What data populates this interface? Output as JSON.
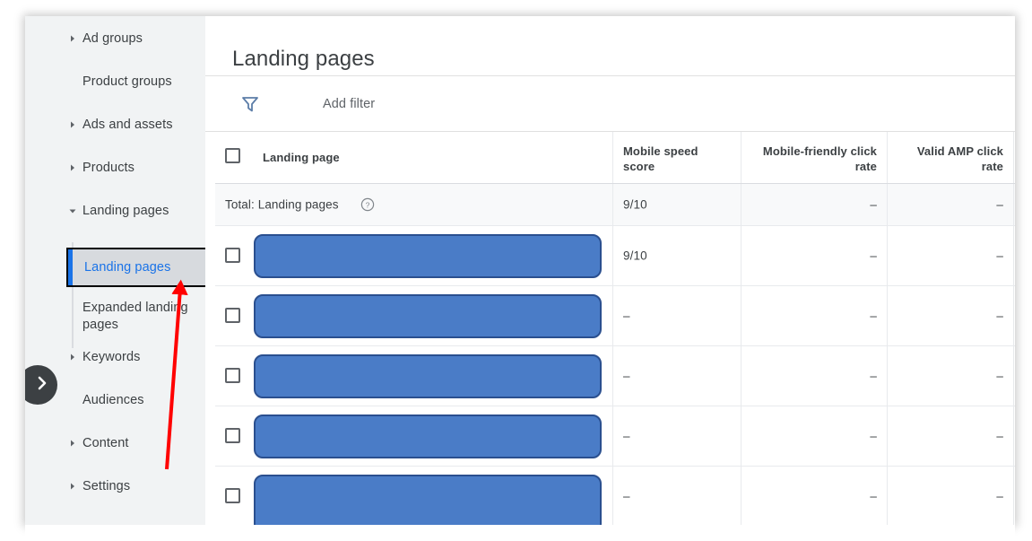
{
  "sidebar": {
    "items": [
      {
        "label": "Ad groups",
        "caret": "collapsed",
        "indent": "top"
      },
      {
        "label": "Product groups",
        "caret": "none",
        "indent": "top"
      },
      {
        "label": "Ads and assets",
        "caret": "collapsed",
        "indent": "top"
      },
      {
        "label": "Products",
        "caret": "collapsed",
        "indent": "top"
      },
      {
        "label": "Landing pages",
        "caret": "expanded",
        "indent": "top"
      },
      {
        "label": "Expanded landing pages",
        "caret": "none",
        "indent": "sub"
      },
      {
        "label": "Keywords",
        "caret": "collapsed",
        "indent": "top"
      },
      {
        "label": "Audiences",
        "caret": "none",
        "indent": "top"
      },
      {
        "label": "Content",
        "caret": "collapsed",
        "indent": "top"
      },
      {
        "label": "Settings",
        "caret": "collapsed",
        "indent": "top"
      }
    ],
    "selected_item": {
      "label": "Landing pages",
      "accent_color": "#1a73e8",
      "background_color": "#d7dade"
    },
    "collapse_button_icon": "chevron-right-icon"
  },
  "header": {
    "title": "Landing pages"
  },
  "filter_bar": {
    "icon": "filter-funnel-icon",
    "add_filter_label": "Add filter"
  },
  "table": {
    "columns": [
      {
        "key": "landing_page",
        "label": "Landing page",
        "align": "left"
      },
      {
        "key": "mobile_speed_score",
        "label": "Mobile speed score",
        "align": "left"
      },
      {
        "key": "mobile_friendly_click_rate",
        "label": "Mobile-friendly click rate",
        "align": "right"
      },
      {
        "key": "valid_amp_click_rate",
        "label": "Valid AMP click rate",
        "align": "right"
      }
    ],
    "total_row": {
      "label": "Total: Landing pages",
      "help_icon": "help-circle-icon",
      "mobile_speed_score": "9/10",
      "mobile_friendly_click_rate": "–",
      "valid_amp_click_rate": "–"
    },
    "rows": [
      {
        "landing_page": "",
        "redacted": true,
        "mobile_speed_score": "9/10",
        "mobile_friendly_click_rate": "–",
        "valid_amp_click_rate": "–"
      },
      {
        "landing_page": "",
        "redacted": true,
        "mobile_speed_score": "–",
        "mobile_friendly_click_rate": "–",
        "valid_amp_click_rate": "–"
      },
      {
        "landing_page": "",
        "redacted": true,
        "mobile_speed_score": "–",
        "mobile_friendly_click_rate": "–",
        "valid_amp_click_rate": "–"
      },
      {
        "landing_page": "",
        "redacted": true,
        "mobile_speed_score": "–",
        "mobile_friendly_click_rate": "–",
        "valid_amp_click_rate": "–"
      },
      {
        "landing_page": "",
        "redacted": true,
        "mobile_speed_score": "–",
        "mobile_friendly_click_rate": "–",
        "valid_amp_click_rate": "–"
      }
    ]
  },
  "annotation": {
    "arrow_color": "#ff0000",
    "points_to": "Landing pages"
  }
}
